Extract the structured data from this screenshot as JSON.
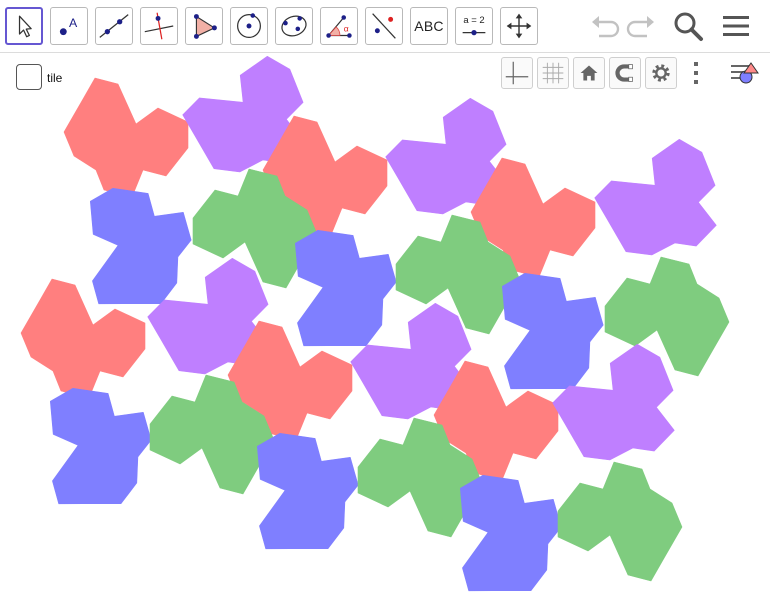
{
  "toolbar": {
    "tools": [
      {
        "name": "move-tool",
        "icon": "cursor-arrow-icon",
        "active": true
      },
      {
        "name": "point-tool",
        "icon": "point-icon",
        "label": "A"
      },
      {
        "name": "line-tool",
        "icon": "line-through-points-icon"
      },
      {
        "name": "perpendicular-line-tool",
        "icon": "perpendicular-line-icon"
      },
      {
        "name": "polygon-tool",
        "icon": "polygon-icon"
      },
      {
        "name": "circle-center-point-tool",
        "icon": "circle-with-center-icon"
      },
      {
        "name": "conic-through-points-tool",
        "icon": "ellipse-points-icon"
      },
      {
        "name": "angle-tool",
        "icon": "angle-icon",
        "label": "α"
      },
      {
        "name": "reflect-tool",
        "icon": "reflect-about-line-icon"
      },
      {
        "name": "text-tool",
        "icon": "text-icon",
        "label": "ABC"
      },
      {
        "name": "slider-tool",
        "icon": "slider-icon",
        "label": "a = 2"
      },
      {
        "name": "move-graphics-view-tool",
        "icon": "move-arrows-icon"
      }
    ],
    "right": [
      "undo-icon",
      "redo-icon",
      "search-icon",
      "menu-icon"
    ]
  },
  "graphics_tools": [
    "axes-toggle-icon",
    "grid-toggle-icon",
    "home-icon",
    "magnet-snap-icon",
    "gear-icon",
    "more-vertical-icon"
  ],
  "style_bar_icon": "style-bar-toggle-icon",
  "checkbox": {
    "label": "tile",
    "checked": false
  },
  "colors": {
    "red": "#ff7f7f",
    "purple": "#bf7fff",
    "blue": "#7f7fff",
    "green": "#7fcc7f",
    "accent": "#6557d2"
  }
}
